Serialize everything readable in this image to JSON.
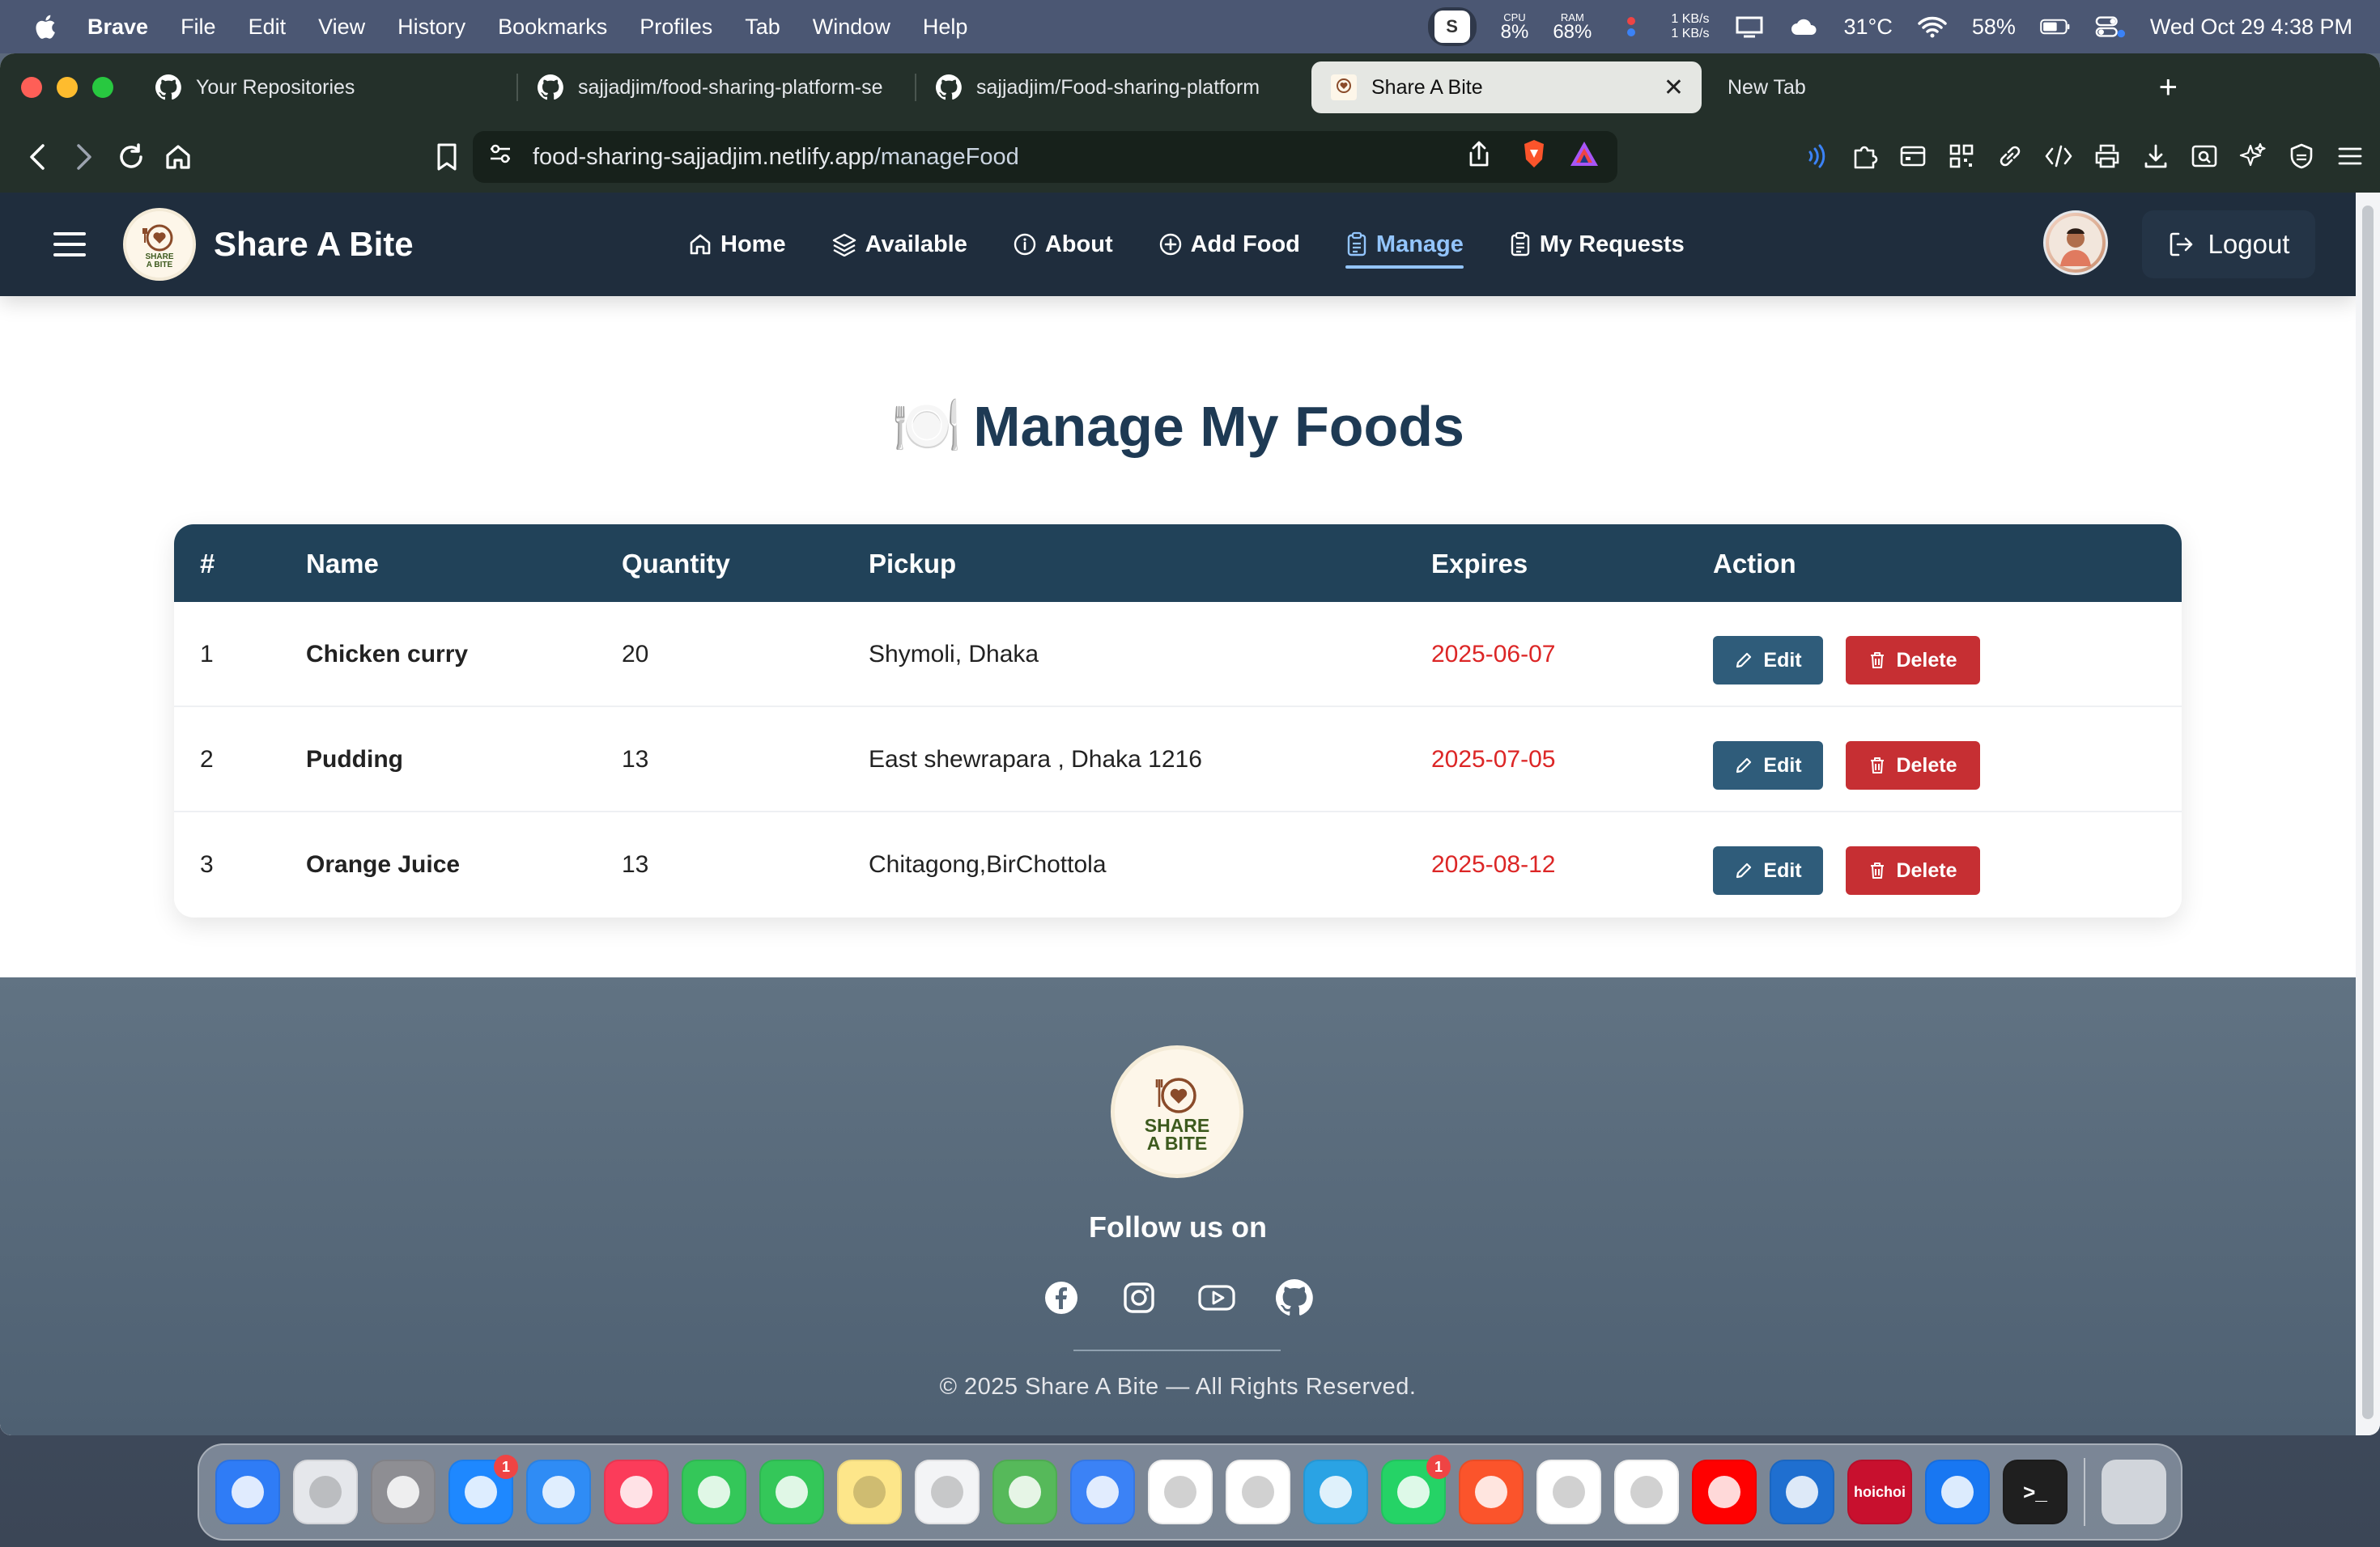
{
  "menubar": {
    "app": "Brave",
    "items": [
      "File",
      "Edit",
      "View",
      "History",
      "Bookmarks",
      "Profiles",
      "Tab",
      "Window",
      "Help"
    ],
    "status": {
      "s_badge": "S",
      "cpu_label": "CPU",
      "cpu_value": "8%",
      "ram_label": "RAM",
      "ram_value": "68%",
      "net_up": "1 KB/s",
      "net_down": "1 KB/s",
      "weather": "31°C",
      "battery": "58%",
      "datetime": "Wed Oct 29  4:38 PM"
    }
  },
  "browser": {
    "tabs": [
      {
        "label": "Your Repositories"
      },
      {
        "label": "sajjadjim/food-sharing-platform-se"
      },
      {
        "label": "sajjadjim/Food-sharing-platform"
      },
      {
        "label": "Share A Bite",
        "close": "✕"
      },
      {
        "label": "New Tab"
      }
    ],
    "new_tab": "+",
    "url_host": "food-sharing-sajjadjim.netlify.app",
    "url_path": "/manageFood"
  },
  "site": {
    "brand": "Share A Bite",
    "nav": [
      {
        "label": "Home"
      },
      {
        "label": "Available"
      },
      {
        "label": "About"
      },
      {
        "label": "Add Food"
      },
      {
        "label": "Manage"
      },
      {
        "label": "My Requests"
      }
    ],
    "logout": "Logout",
    "page_title": "Manage My Foods",
    "page_title_emoji": "🍽️",
    "table": {
      "headers": [
        "#",
        "Name",
        "Quantity",
        "Pickup",
        "Expires",
        "Action"
      ],
      "rows": [
        {
          "num": "1",
          "name": "Chicken curry",
          "qty": "20",
          "pickup": "Shymoli, Dhaka",
          "expires": "2025-06-07"
        },
        {
          "num": "2",
          "name": "Pudding",
          "qty": "13",
          "pickup": "East shewrapara , Dhaka 1216",
          "expires": "2025-07-05"
        },
        {
          "num": "3",
          "name": "Orange Juice",
          "qty": "13",
          "pickup": "Chitagong,BirChottola",
          "expires": "2025-08-12"
        }
      ],
      "edit_label": "Edit",
      "delete_label": "Delete"
    },
    "footer": {
      "logo_line1": "SHARE",
      "logo_line2": "A BITE",
      "follow": "Follow us on",
      "socials": [
        "facebook-icon",
        "instagram-icon",
        "youtube-icon",
        "github-icon"
      ],
      "copyright": "© 2025 Share A Bite — All Rights Reserved."
    }
  },
  "dock": {
    "apps": [
      {
        "name": "finder",
        "color": "#2f7cf6"
      },
      {
        "name": "launchpad",
        "color": "#e5e7eb"
      },
      {
        "name": "system-settings",
        "color": "#8e8e93"
      },
      {
        "name": "app-store",
        "color": "#1e88ff",
        "badge": "1"
      },
      {
        "name": "safari",
        "color": "#2f8cf5"
      },
      {
        "name": "music",
        "color": "#fb3c5a"
      },
      {
        "name": "phone",
        "color": "#34c759"
      },
      {
        "name": "messages",
        "color": "#34c759"
      },
      {
        "name": "notes",
        "color": "#fde68a"
      },
      {
        "name": "reminders",
        "color": "#f3f4f6"
      },
      {
        "name": "maps",
        "color": "#56b95a"
      },
      {
        "name": "weather",
        "color": "#3b82f6"
      },
      {
        "name": "gmail",
        "color": "#ffffff"
      },
      {
        "name": "photos",
        "color": "#ffffff"
      },
      {
        "name": "telegram",
        "color": "#2aa3e4"
      },
      {
        "name": "whatsapp",
        "color": "#25d366",
        "badge": "1"
      },
      {
        "name": "brave",
        "color": "#fb542b"
      },
      {
        "name": "chatgpt",
        "color": "#ffffff"
      },
      {
        "name": "chrome",
        "color": "#ffffff"
      },
      {
        "name": "youtube",
        "color": "#ff0000"
      },
      {
        "name": "vscode",
        "color": "#1f6fd0"
      },
      {
        "name": "hoichoi",
        "color": "#c8102e",
        "label": "hoichoi"
      },
      {
        "name": "messenger",
        "color": "#1877f2"
      },
      {
        "name": "terminal",
        "color": "#1f1f1f",
        "label": ">_"
      }
    ],
    "trash_color": "#d1d5db"
  }
}
